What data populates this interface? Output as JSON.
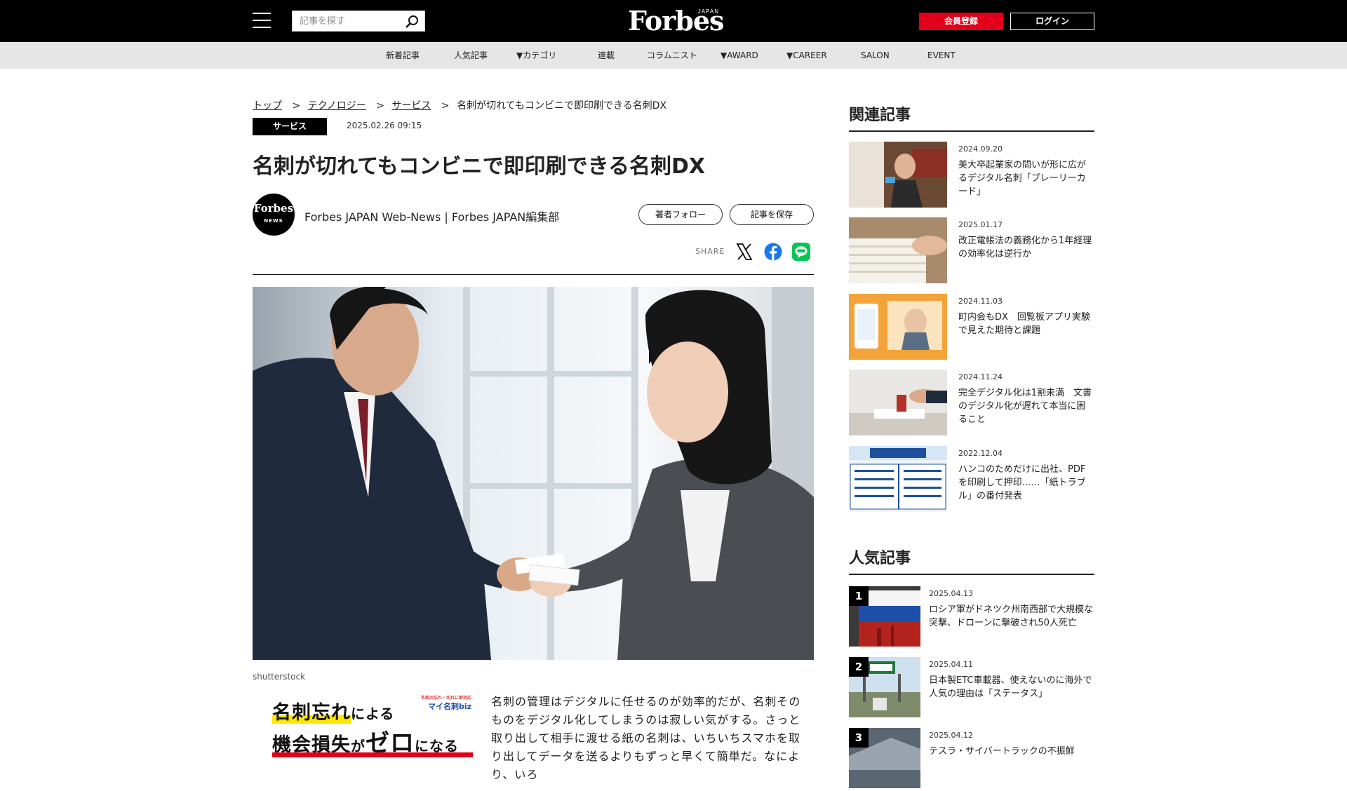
{
  "header": {
    "search_placeholder": "記事を探す",
    "logo_text": "Forbes",
    "logo_sub": "JAPAN",
    "register_label": "会員登録",
    "login_label": "ログイン"
  },
  "nav": {
    "items": [
      "新着記事",
      "人気記事",
      "▼カテゴリ",
      "連載",
      "コラムニスト",
      "▼AWARD",
      "▼CAREER",
      "SALON",
      "EVENT"
    ]
  },
  "breadcrumb": {
    "items": [
      "トップ",
      "テクノロジー",
      "サービス"
    ],
    "separator": ">",
    "current": "名刺が切れてもコンビニで即印刷できる名刺DX"
  },
  "article": {
    "category": "サービス",
    "date": "2025.02.26 09:15",
    "title": "名刺が切れてもコンビニで即印刷できる名刺DX",
    "author_badge_main": "Forbes",
    "author_badge_sub": "NEWS",
    "author": "Forbes JAPAN Web-News | Forbes JAPAN編集部",
    "follow_label": "著者フォロー",
    "save_label": "記事を保存",
    "share_label": "SHARE",
    "share_icons": [
      "x-icon",
      "facebook-icon",
      "line-icon"
    ],
    "image_caption": "shutterstock",
    "body": "名刺の管理はデジタルに任せるのが効率的だが、名刺そのものをデジタル化してしまうのは寂しい気がする。さっと取り出して相手に渡せる紙の名刺は、いちいちスマホを取り出してデータを送るよりもずっと早くて簡単だ。なにより、いろ"
  },
  "ad": {
    "line1_a": "名刺忘れ",
    "line1_b": "による",
    "line2_a": "機会損失",
    "line2_b": "が",
    "line2_c": "ゼロ",
    "line2_d": "になる",
    "brand_small": "名刺の忘れ・切れに即対応",
    "brand": "マイ名刺biz"
  },
  "sidebar": {
    "related_heading": "関連記事",
    "related": [
      {
        "date": "2024.09.20",
        "title": "美大卒起業家の問いが形に広がるデジタル名刺「プレーリーカード」"
      },
      {
        "date": "2025.01.17",
        "title": "改正電帳法の義務化から1年経理の効率化は逆行か"
      },
      {
        "date": "2024.11.03",
        "title": "町内会もDX　回覧板アプリ実験で見えた期待と課題"
      },
      {
        "date": "2024.11.24",
        "title": "完全デジタル化は1割未満　文書のデジタル化が遅れて本当に困ること"
      },
      {
        "date": "2022.12.04",
        "title": "ハンコのためだけに出社、PDFを印刷して押印……「紙トラブル」の番付発表"
      }
    ],
    "popular_heading": "人気記事",
    "popular": [
      {
        "rank": "1",
        "date": "2025.04.13",
        "title": "ロシア軍がドネツク州南西部で大規模な突撃、ドローンに撃破され50人死亡"
      },
      {
        "rank": "2",
        "date": "2025.04.11",
        "title": "日本製ETC車載器、使えないのに海外で人気の理由は「ステータス」"
      },
      {
        "rank": "3",
        "date": "2025.04.12",
        "title": "テスラ・サイバートラックの不振鮮"
      }
    ]
  },
  "colors": {
    "header_bg": "#000000",
    "nav_bg": "#e6e6e6",
    "accent_red": "#e2001a",
    "line_green": "#06c755",
    "facebook_blue": "#1877f2"
  }
}
